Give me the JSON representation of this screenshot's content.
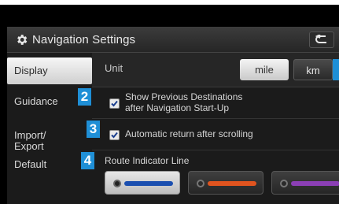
{
  "header": {
    "title": "Navigation Settings",
    "back_icon": "back-arrow-icon",
    "settings_icon": "gear-icon"
  },
  "sidebar": {
    "items": [
      {
        "label": "Display",
        "active": true
      },
      {
        "label": "Guidance",
        "active": false
      },
      {
        "label": "Import/\nExport",
        "active": false
      },
      {
        "label": "Default",
        "active": false
      }
    ]
  },
  "content": {
    "unit": {
      "label": "Unit",
      "options": [
        "mile",
        "km"
      ],
      "selected": "mile"
    },
    "show_previous_destinations": {
      "label": "Show Previous Destinations\nafter Navigation Start-Up",
      "checked": true
    },
    "auto_return": {
      "label": "Automatic return after scrolling",
      "checked": true
    },
    "route_indicator": {
      "label": "Route Indicator Line",
      "options": [
        {
          "color": "#1b4fb0",
          "selected": true
        },
        {
          "color": "#e0541f",
          "selected": false
        },
        {
          "color": "#8b3fb5",
          "selected": false
        }
      ]
    }
  },
  "callouts": [
    "2",
    "3",
    "4"
  ],
  "colors": {
    "accent": "#1f8fd6",
    "background": "#1b1b1b"
  }
}
